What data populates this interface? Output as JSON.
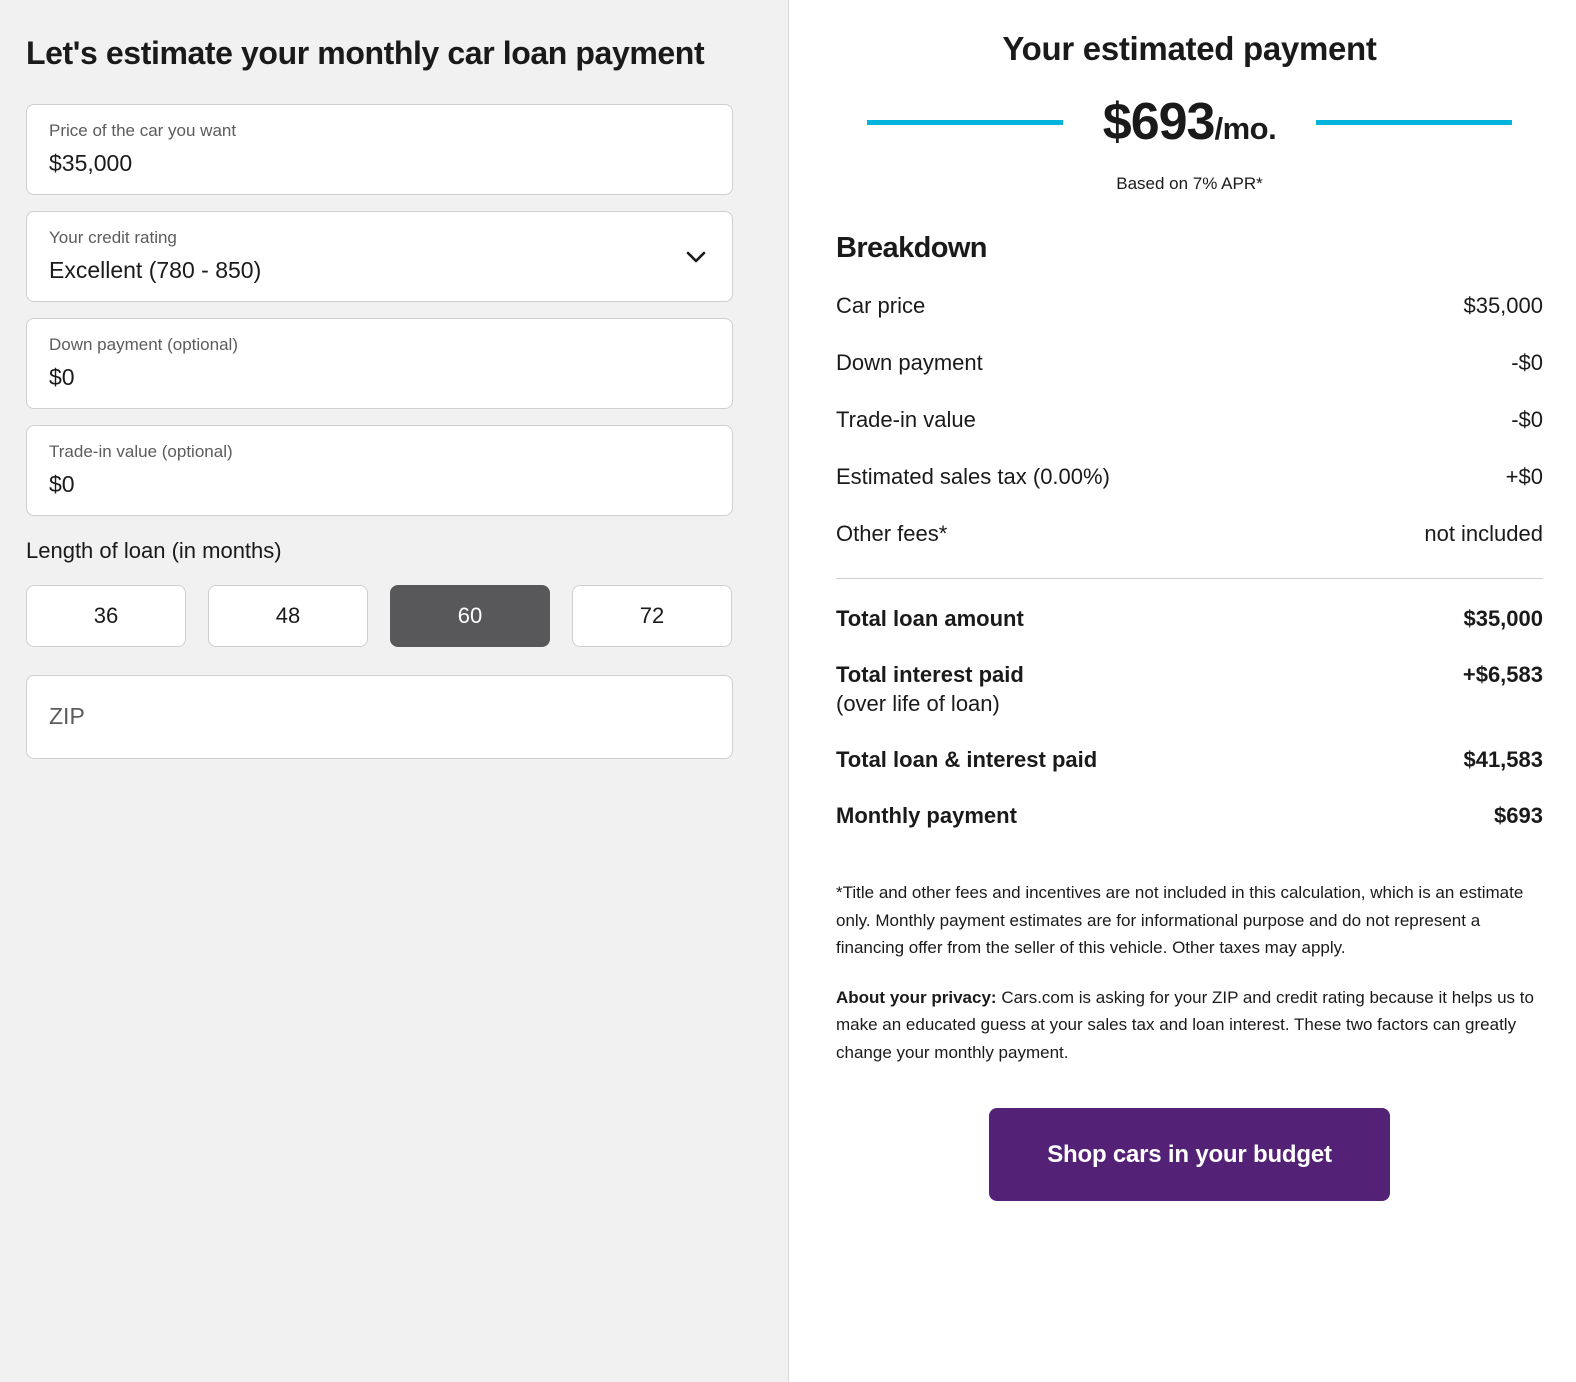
{
  "form": {
    "title": "Let's estimate your monthly car loan payment",
    "fields": [
      {
        "label": "Price of the car you want",
        "value": "$35,000",
        "name": "car-price"
      },
      {
        "label": "Your credit rating",
        "value": "Excellent (780 - 850)",
        "name": "credit-rating"
      },
      {
        "label": "Down payment (optional)",
        "value": "$0",
        "name": "down-payment"
      },
      {
        "label": "Trade-in value (optional)",
        "value": "$0",
        "name": "trade-in-value"
      }
    ],
    "credit_rating_chevron_icon": "chevron-down-icon",
    "loan_length_label": "Length of loan (in months)",
    "loan_terms": [
      "36",
      "48",
      "60",
      "72"
    ],
    "selected_loan_term": "60",
    "zip_placeholder": "ZIP",
    "zip_value": ""
  },
  "estimate": {
    "title": "Your estimated payment",
    "amount": "$693",
    "per_period": "/mo.",
    "apr_note": "Based on 7% APR*",
    "accent_color": "#03b3dc"
  },
  "breakdown": {
    "heading": "Breakdown",
    "rows": [
      {
        "label": "Car price",
        "value": "$35,000"
      },
      {
        "label": "Down payment",
        "value": "-$0"
      },
      {
        "label": "Trade-in value",
        "value": "-$0"
      },
      {
        "label": "Estimated sales tax (0.00%)",
        "value": "+$0"
      },
      {
        "label": "Other fees*",
        "value": "not included"
      }
    ],
    "totals": [
      {
        "label": "Total loan amount",
        "sub": "",
        "value": "$35,000"
      },
      {
        "label": "Total interest paid",
        "sub": "(over life of loan)",
        "value": "+$6,583"
      },
      {
        "label": "Total loan & interest paid",
        "sub": "",
        "value": "$41,583"
      },
      {
        "label": "Monthly payment",
        "sub": "",
        "value": "$693"
      }
    ]
  },
  "footer": {
    "disclaimer": "*Title and other fees and incentives are not included in this calculation, which is an estimate only. Monthly payment estimates are for informational purpose and do not represent a financing offer from the seller of this vehicle. Other taxes may apply.",
    "privacy_label": "About your privacy:",
    "privacy_text": " Cars.com is asking for your ZIP and credit rating because it helps us to make an educated guess at your sales tax and loan interest. These two factors can greatly change your monthly payment.",
    "cta_label": "Shop cars in your budget",
    "cta_color": "#532277"
  }
}
